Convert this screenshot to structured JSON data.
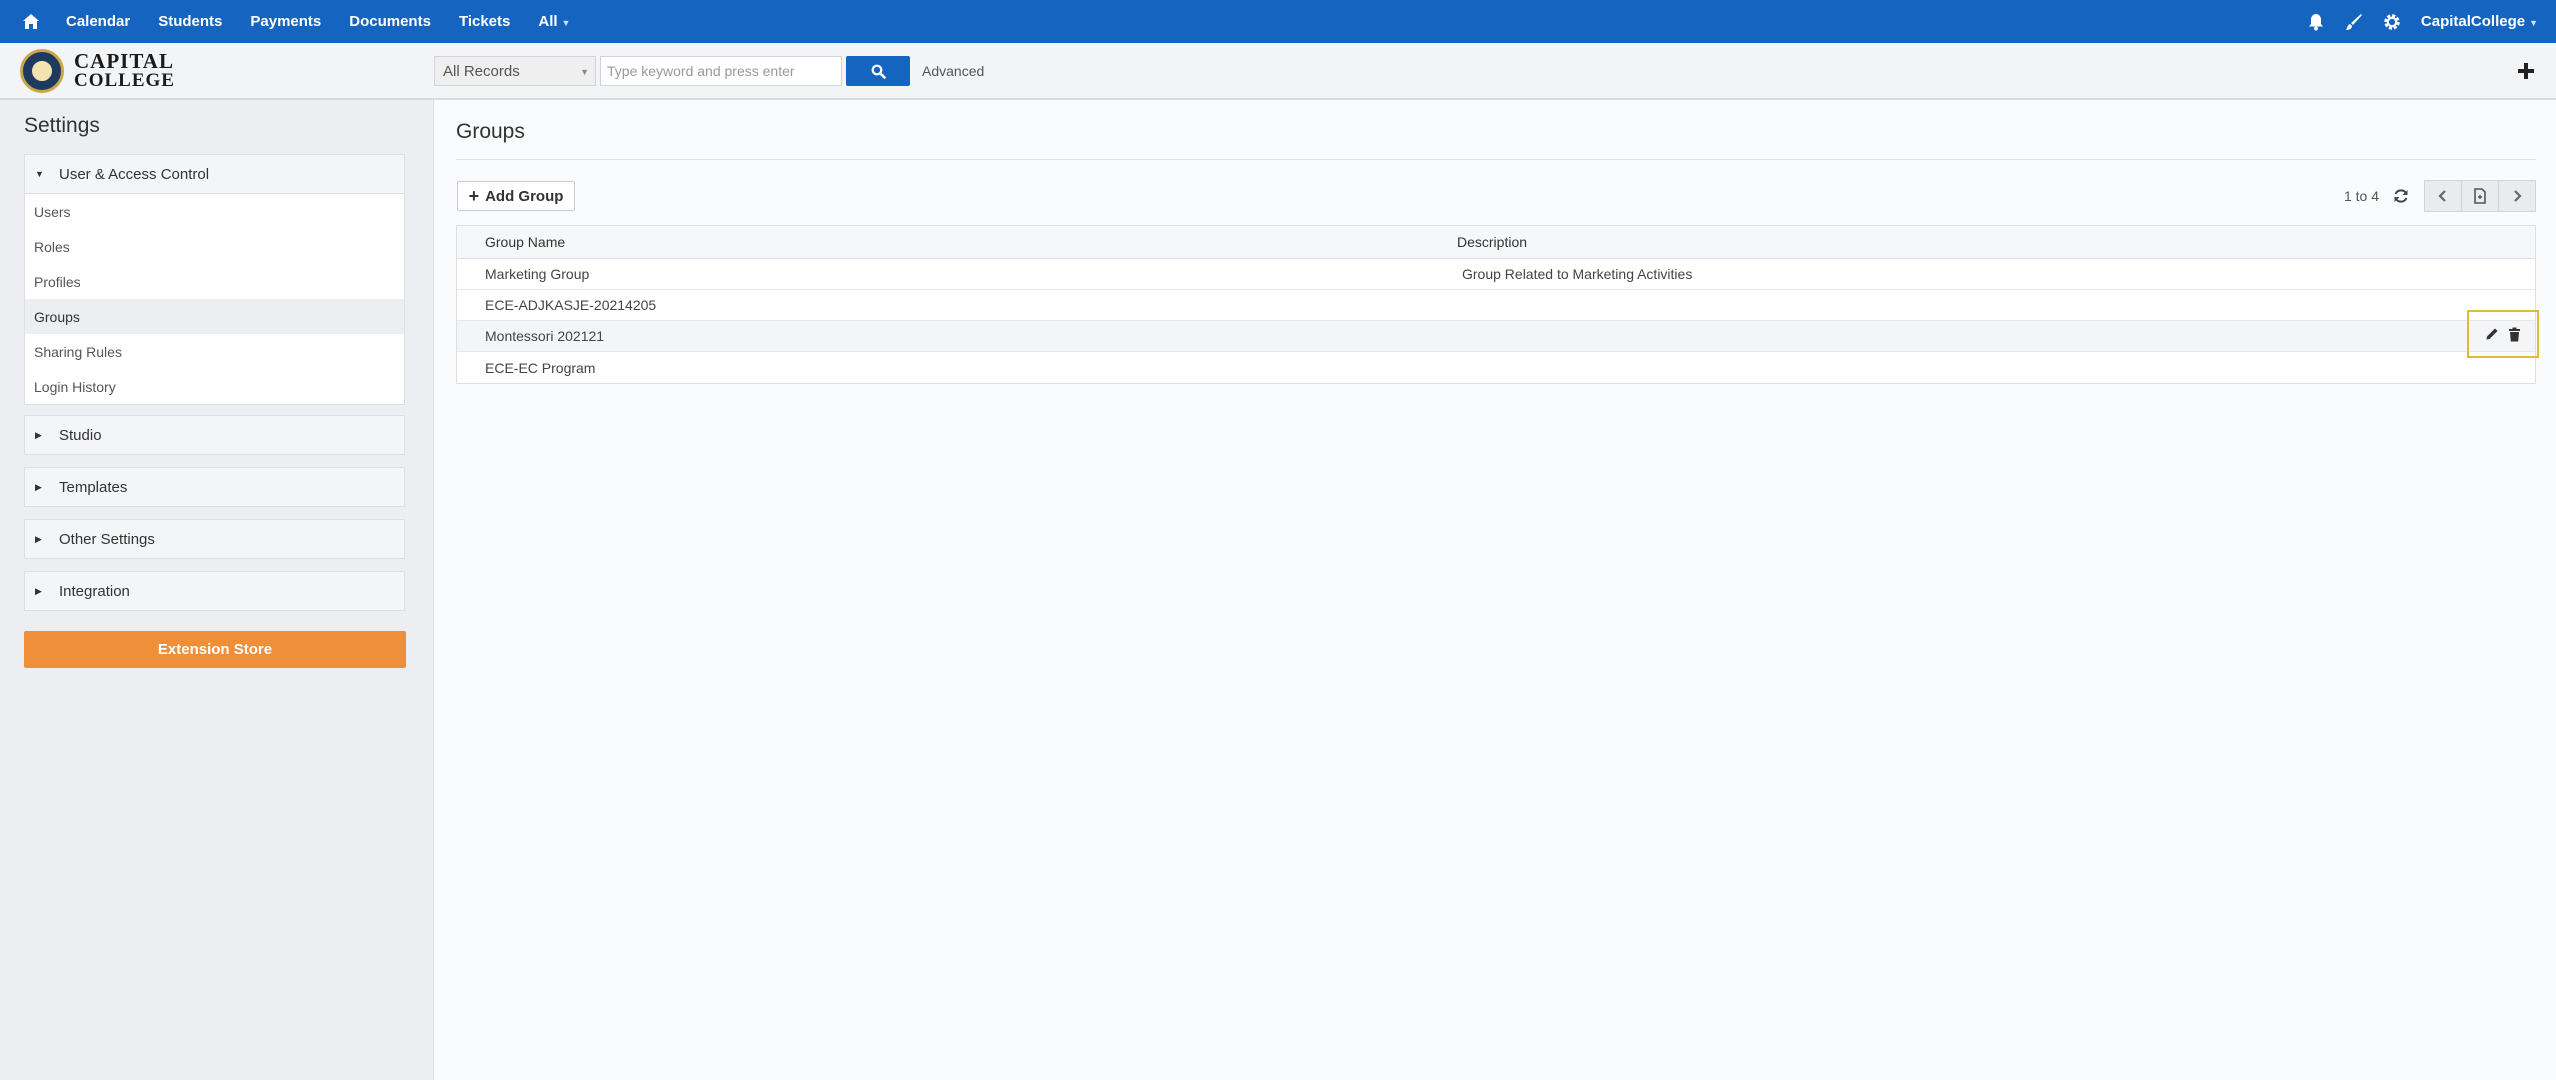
{
  "topnav": {
    "menu": [
      {
        "label": "Calendar"
      },
      {
        "label": "Students"
      },
      {
        "label": "Payments"
      },
      {
        "label": "Documents"
      },
      {
        "label": "Tickets"
      },
      {
        "label": "All"
      }
    ],
    "user": "CapitalCollege"
  },
  "logo": {
    "line1": "CAPITAL",
    "line2": "COLLEGE"
  },
  "search": {
    "record_type": "All Records",
    "placeholder": "Type keyword and press enter",
    "advanced": "Advanced"
  },
  "sidebar": {
    "title": "Settings",
    "sections": [
      {
        "label": "User & Access Control",
        "expanded": true,
        "items": [
          "Users",
          "Roles",
          "Profiles",
          "Groups",
          "Sharing Rules",
          "Login History"
        ],
        "active": "Groups"
      },
      {
        "label": "Studio",
        "expanded": false
      },
      {
        "label": "Templates",
        "expanded": false
      },
      {
        "label": "Other Settings",
        "expanded": false
      },
      {
        "label": "Integration",
        "expanded": false
      }
    ],
    "extension_store": "Extension Store"
  },
  "main": {
    "title": "Groups",
    "add_button": "Add Group",
    "pager_text": "1 to 4",
    "columns": [
      "Group Name",
      "Description"
    ],
    "rows": [
      {
        "name": "Marketing Group",
        "description": "Group Related to Marketing Activities"
      },
      {
        "name": "ECE-ADJKASJE-20214205",
        "description": ""
      },
      {
        "name": "Montessori 202121",
        "description": ""
      },
      {
        "name": "ECE-EC Program",
        "description": ""
      }
    ]
  },
  "colors": {
    "nav": "#1565c0",
    "accent_orange": "#ef8f3a",
    "highlight": "#e0b93a"
  }
}
